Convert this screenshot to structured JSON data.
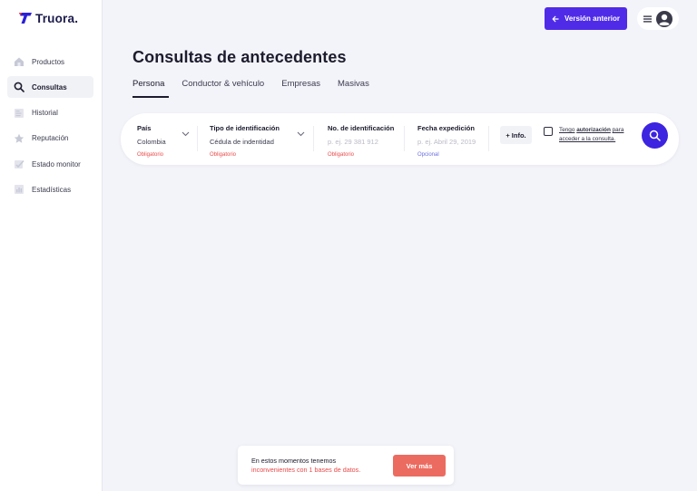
{
  "brand": {
    "name": "Truora."
  },
  "sidebar": {
    "items": [
      {
        "label": "Productos",
        "icon": "home-icon",
        "active": false
      },
      {
        "label": "Consultas",
        "icon": "search-icon",
        "active": true
      },
      {
        "label": "Historial",
        "icon": "history-icon",
        "active": false
      },
      {
        "label": "Reputación",
        "icon": "star-icon",
        "active": false
      },
      {
        "label": "Estado monitor",
        "icon": "monitor-icon",
        "active": false
      },
      {
        "label": "Estadísticas",
        "icon": "stats-icon",
        "active": false
      }
    ]
  },
  "header": {
    "back_button": "Versión anterior",
    "menu_icon": "hamburger-icon",
    "avatar_icon": "user-avatar-icon"
  },
  "page": {
    "title": "Consultas de antecedentes",
    "tabs": [
      {
        "label": "Persona",
        "active": true
      },
      {
        "label": "Conductor & vehículo",
        "active": false
      },
      {
        "label": "Empresas",
        "active": false
      },
      {
        "label": "Masivas",
        "active": false
      }
    ]
  },
  "search": {
    "country": {
      "label": "País",
      "value": "Colombia",
      "note": "Obligatorio"
    },
    "id_type": {
      "label": "Tipo de identificación",
      "value": "Cédula de indentidad",
      "note": "Obligatorio"
    },
    "id_number": {
      "label": "No. de identificación",
      "placeholder": "p. ej. 29 381 912",
      "note": "Obligatorio"
    },
    "issue_date": {
      "label": "Fecha expedición",
      "placeholder": "p. ej. Abril 29, 2019",
      "note": "Opcional"
    },
    "info_button": "+ Info.",
    "auth_prefix": "Tengo",
    "auth_bold": "autorización",
    "auth_suffix": "para acceder a la consulta.",
    "checked": false
  },
  "toast": {
    "line1": "En estos momentos tenemos",
    "line2": "inconvenientes con 1 bases de datos.",
    "button": "Ver más"
  },
  "colors": {
    "primary": "#4f2be8",
    "search_button": "#3d24e0",
    "error": "#ea4b4b",
    "optional": "#6b6fe0",
    "toast_button": "#ec6b60",
    "background": "#f3f4f9"
  }
}
